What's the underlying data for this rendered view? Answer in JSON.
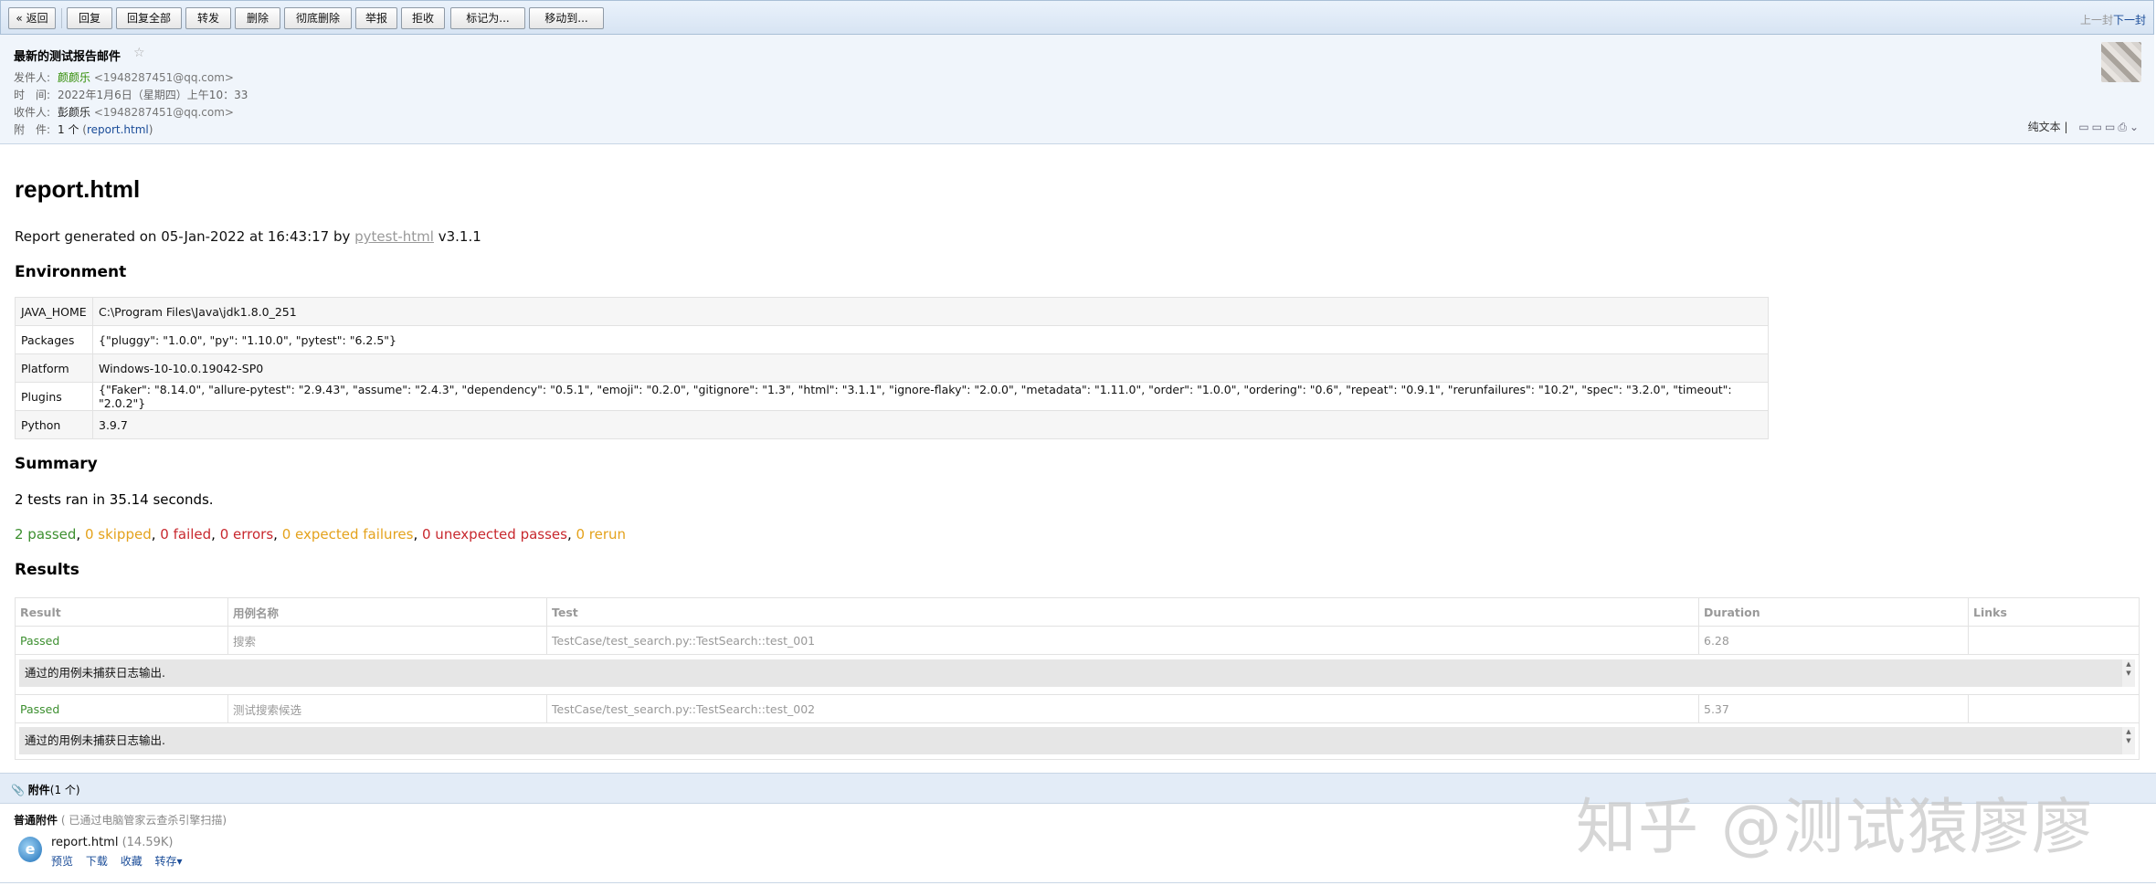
{
  "toolbar": {
    "back": "« 返回",
    "reply": "回复",
    "reply_all": "回复全部",
    "forward": "转发",
    "delete": "删除",
    "delete_permanent": "彻底删除",
    "report": "举报",
    "reject": "拒收",
    "mark_as": "标记为...",
    "move_to": "移动到...",
    "prev": "上一封",
    "next": "下一封"
  },
  "mail": {
    "subject": "最新的测试报告邮件",
    "from_label": "发件人:",
    "from_name": "颜颜乐",
    "from_addr": "<1948287451@qq.com>",
    "time_label": "时　间:",
    "time_value": "2022年1月6日（星期四）上午10：33",
    "to_label": "收件人:",
    "to_name": "彭颜乐",
    "to_addr": "<1948287451@qq.com>",
    "attach_label": "附　件:",
    "attach_count": "1 个",
    "attach_file": "report.html",
    "plain_text": "纯文本"
  },
  "report": {
    "title": "report.html",
    "generated_prefix": "Report generated on 05-Jan-2022 at 16:43:17 by ",
    "generated_link": "pytest-html",
    "generated_suffix": " v3.1.1",
    "env_heading": "Environment",
    "environment": [
      {
        "key": "JAVA_HOME",
        "value": "C:\\Program Files\\Java\\jdk1.8.0_251"
      },
      {
        "key": "Packages",
        "value": "{\"pluggy\": \"1.0.0\", \"py\": \"1.10.0\", \"pytest\": \"6.2.5\"}"
      },
      {
        "key": "Platform",
        "value": "Windows-10-10.0.19042-SP0"
      },
      {
        "key": "Plugins",
        "value": "{\"Faker\": \"8.14.0\", \"allure-pytest\": \"2.9.43\", \"assume\": \"2.4.3\", \"dependency\": \"0.5.1\", \"emoji\": \"0.2.0\", \"gitignore\": \"1.3\", \"html\": \"3.1.1\", \"ignore-flaky\": \"2.0.0\", \"metadata\": \"1.11.0\", \"order\": \"1.0.0\", \"ordering\": \"0.6\", \"repeat\": \"0.9.1\", \"rerunfailures\": \"10.2\", \"spec\": \"3.2.0\", \"timeout\": \"2.0.2\"}"
      },
      {
        "key": "Python",
        "value": "3.9.7"
      }
    ],
    "summary_heading": "Summary",
    "summary_text": "2 tests ran in 35.14 seconds.",
    "counts": {
      "passed": "2 passed",
      "skipped": "0 skipped",
      "failed": "0 failed",
      "errors": "0 errors",
      "expected_failures": "0 expected failures",
      "unexpected_passes": "0 unexpected passes",
      "rerun": "0 rerun"
    },
    "results_heading": "Results",
    "results_columns": [
      "Result",
      "用例名称",
      "Test",
      "Duration",
      "Links"
    ],
    "results": [
      {
        "result": "Passed",
        "name": "搜索",
        "test": "TestCase/test_search.py::TestSearch::test_001",
        "duration": "6.28",
        "links": "",
        "log": "通过的用例未捕获日志输出."
      },
      {
        "result": "Passed",
        "name": "测试搜索候选",
        "test": "TestCase/test_search.py::TestSearch::test_002",
        "duration": "5.37",
        "links": "",
        "log": "通过的用例未捕获日志输出."
      }
    ]
  },
  "attachments": {
    "bar_title": "附件",
    "bar_count": "(1 个)",
    "section_label": "普通附件",
    "scan_note": "( 已通过电脑管家云查杀引擎扫描)",
    "file_name": "report.html",
    "file_size": "(14.59K)",
    "actions": [
      "预览",
      "下载",
      "收藏",
      "转存▾"
    ]
  },
  "watermark": "知乎 @测试猿廖廖",
  "icons": {
    "star": "star-icon",
    "paperclip": "paperclip-icon",
    "file": "ie-file-icon"
  }
}
